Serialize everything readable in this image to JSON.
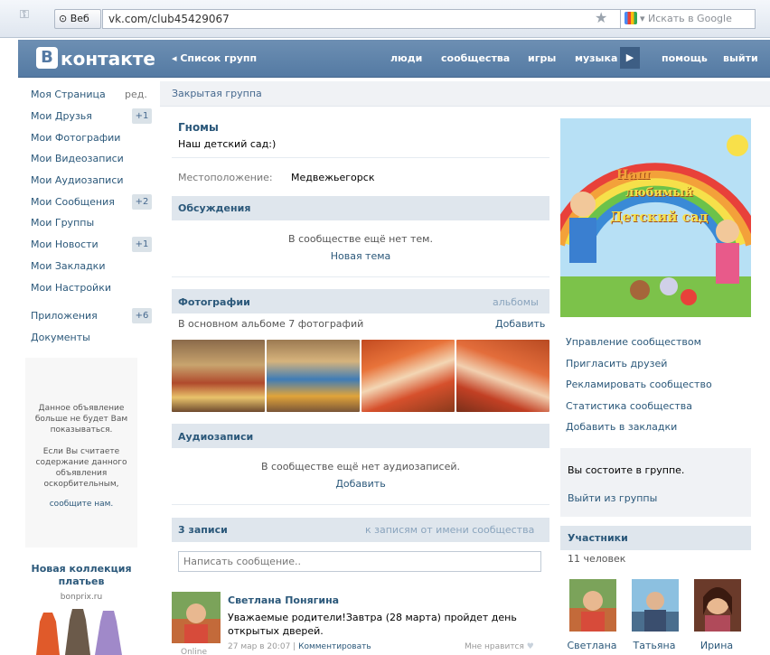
{
  "browser": {
    "web_label": "Веб",
    "url": "vk.com/club45429067",
    "search_placeholder": "Искать в Google"
  },
  "header": {
    "logo": "контакте",
    "logo_letter": "В",
    "back": "◂ Список групп",
    "nav": [
      "люди",
      "сообщества",
      "игры",
      "музыка",
      "помощь",
      "выйти"
    ]
  },
  "left_menu": {
    "edit": "ред.",
    "items": [
      {
        "label": "Моя Страница",
        "count": ""
      },
      {
        "label": "Мои Друзья",
        "count": "+1"
      },
      {
        "label": "Мои Фотографии",
        "count": ""
      },
      {
        "label": "Мои Видеозаписи",
        "count": ""
      },
      {
        "label": "Мои Аудиозаписи",
        "count": ""
      },
      {
        "label": "Мои Сообщения",
        "count": "+2"
      },
      {
        "label": "Мои Группы",
        "count": ""
      },
      {
        "label": "Мои Новости",
        "count": "+1"
      },
      {
        "label": "Мои Закладки",
        "count": ""
      },
      {
        "label": "Мои Настройки",
        "count": ""
      }
    ],
    "apps": {
      "label": "Приложения",
      "count": "+6"
    },
    "docs": "Документы"
  },
  "ad": {
    "removed_line1": "Данное объявление",
    "removed_line2": "больше не будет Вам",
    "removed_line3": "показываться.",
    "report_line1": "Если Вы считаете",
    "report_line2": "содержание данного",
    "report_line3": "объявления",
    "report_line4": "оскорбительным,",
    "report_link": "сообщите нам.",
    "title_line1": "Новая коллекция",
    "title_line2": "платьев",
    "source": "bonprix.ru"
  },
  "group": {
    "closed_label": "Закрытая группа",
    "name": "Гномы",
    "status": "Наш детский сад:)",
    "location_label": "Местоположение:",
    "location_value": "Медвежьегорск"
  },
  "discussions": {
    "title": "Обсуждения",
    "empty": "В сообществе ещё нет тем.",
    "action": "Новая тема"
  },
  "photos": {
    "title": "Фотографии",
    "albums": "альбомы",
    "subtitle": "В основном альбоме 7 фотографий",
    "add": "Добавить"
  },
  "audio": {
    "title": "Аудиозаписи",
    "empty": "В сообществе ещё нет аудиозаписей.",
    "add": "Добавить"
  },
  "wall": {
    "count_label": "3 записи",
    "as_community": "к записям от имени сообщества",
    "input_placeholder": "Написать сообщение..",
    "post": {
      "author": "Светлана Понягина",
      "text": "Уважаемые родители!Завтра (28 марта) пройдет день открытых дверей.",
      "date": "27 мар в 20:07",
      "comment": "Комментировать",
      "like": "Мне нравится",
      "online": "Online"
    }
  },
  "right": {
    "cover_title_1": "Наш",
    "cover_title_2": "любимый",
    "cover_title_3": "Детский сад",
    "links": [
      "Управление сообществом",
      "Пригласить друзей",
      "Рекламировать сообщество",
      "Статистика сообщества",
      "Добавить в закладки"
    ],
    "member_status": "Вы состоите в группе.",
    "leave": "Выйти из группы",
    "members_title": "Участники",
    "members_count": "11 человек",
    "members": [
      "Светлана",
      "Татьяна",
      "Ирина"
    ]
  }
}
